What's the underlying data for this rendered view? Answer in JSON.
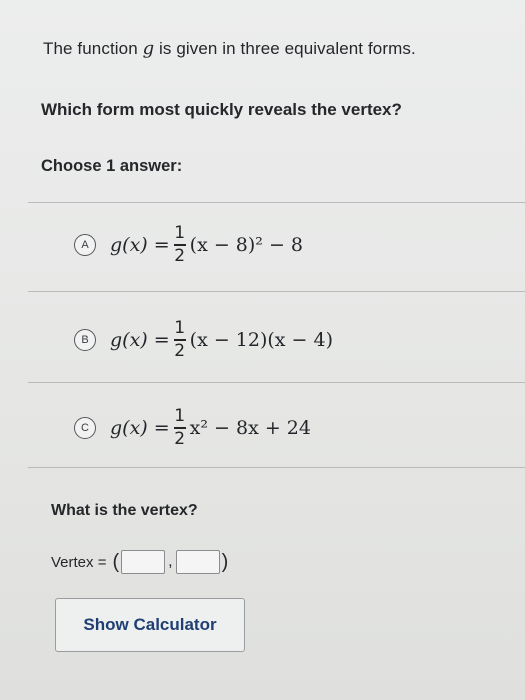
{
  "prompt": {
    "before": "The function ",
    "variable": "g",
    "after": " is given in three equivalent forms."
  },
  "question": "Which form most quickly reveals the vertex?",
  "choose_label": "Choose 1 answer:",
  "choices": [
    {
      "letter": "A",
      "lhs": "g(x) = ",
      "frac_num": "1",
      "frac_den": "2",
      "rhs": "(x − 8)² − 8"
    },
    {
      "letter": "B",
      "lhs": "g(x) = ",
      "frac_num": "1",
      "frac_den": "2",
      "rhs": "(x − 12)(x − 4)"
    },
    {
      "letter": "C",
      "lhs": "g(x) = ",
      "frac_num": "1",
      "frac_den": "2",
      "rhs": "x² − 8x + 24"
    }
  ],
  "vertex_question": "What is the vertex?",
  "vertex": {
    "label": "Vertex =",
    "open_paren": "(",
    "comma": ",",
    "close_paren": ")",
    "x_value": "",
    "y_value": ""
  },
  "calculator_button": "Show Calculator",
  "colors": {
    "background": "#e7e8e6",
    "link_blue": "#1f3e73",
    "divider": "#b9bbbb"
  }
}
